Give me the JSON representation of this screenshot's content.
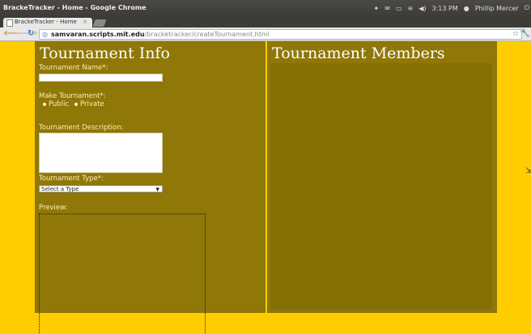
{
  "window": {
    "title": "BrackeTracker - Home - Google Chrome"
  },
  "panel": {
    "time": "3:13 PM",
    "user": "Phillip Mercer",
    "icons": [
      "dropbox-icon",
      "mail-icon",
      "battery-icon",
      "wifi-icon",
      "volume-icon",
      "user-icon",
      "power-icon"
    ]
  },
  "tab": {
    "title": "BrackeTracker - Home",
    "close": "×"
  },
  "address": {
    "host": "samvaran.scripts.mit.edu",
    "path": "/bracketracker/createTournament.html"
  },
  "left": {
    "title": "Tournament Info",
    "name_label": "Tournament Name*:",
    "make_label": "Make Tournament*:",
    "public_label": "Public",
    "private_label": "Private",
    "desc_label": "Tournament Description:",
    "type_label": "Tournament Type*:",
    "type_selected": "Select a Type",
    "preview_label": "Preview:"
  },
  "right": {
    "title": "Tournament Members"
  },
  "colors": {
    "page_bg": "#ffcc00",
    "panel_bg": "#8f7708",
    "heading": "#ffffff"
  }
}
